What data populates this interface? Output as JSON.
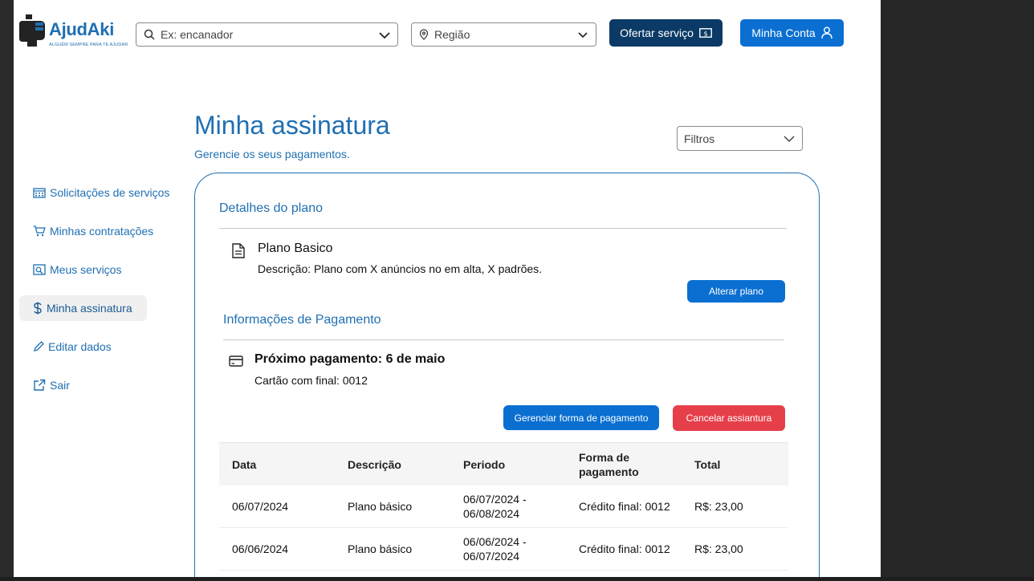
{
  "header": {
    "logo": {
      "name": "AjudAki",
      "tagline": "ALGUÉM SEMPRE PARA TE AJUDAR"
    },
    "search": {
      "placeholder": "Ex: encanador"
    },
    "region": {
      "placeholder": "Região"
    },
    "offer_button": "Ofertar serviço",
    "account_button": "Minha Conta"
  },
  "page": {
    "title": "Minha assinatura",
    "subtitle": "Gerencie os seus pagamentos.",
    "filters": "Filtros"
  },
  "sidebar": {
    "items": [
      {
        "label": "Solicitações de serviços",
        "icon": "calendar-icon"
      },
      {
        "label": "Minhas contratações",
        "icon": "cart-icon"
      },
      {
        "label": "Meus serviços",
        "icon": "services-icon"
      },
      {
        "label": "Minha assinatura",
        "icon": "dollar-icon",
        "active": true
      },
      {
        "label": "Editar dados",
        "icon": "pencil-icon"
      },
      {
        "label": "Sair",
        "icon": "external-link-icon"
      }
    ]
  },
  "plan": {
    "section_title": "Detalhes do plano",
    "name": "Plano Basico",
    "description": "Descrição: Plano com X anúncios no em alta, X padrões.",
    "change_button": "Alterar plano"
  },
  "payment": {
    "section_title": "Informações de Pagamento",
    "next_payment": "Próximo pagamento: 6 de maio",
    "card_ending": "Cartão com final: 0012",
    "manage_button": "Gerenciar forma de pagamento",
    "cancel_button": "Cancelar assiantura"
  },
  "table": {
    "headers": [
      "Data",
      "Descrição",
      "Periodo",
      "Forma de pagamento",
      "Total"
    ],
    "rows": [
      [
        "06/07/2024",
        "Plano básico",
        "06/07/2024 - 06/08/2024",
        "Crédito final: 0012",
        "R$: 23,00"
      ],
      [
        "06/06/2024",
        "Plano básico",
        "06/06/2024 - 06/07/2024",
        "Crédito final: 0012",
        "R$: 23,00"
      ]
    ]
  },
  "colors": {
    "primary": "#1f6fb2",
    "button_blue": "#0a6fd1",
    "button_dark": "#0b3a66",
    "danger": "#e5404a"
  }
}
